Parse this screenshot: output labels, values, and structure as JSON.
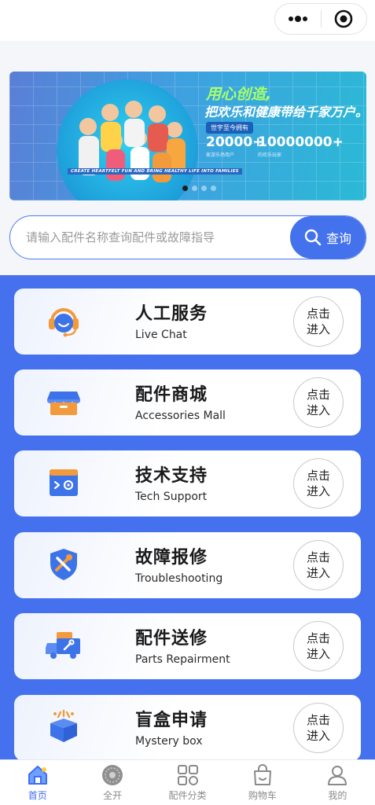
{
  "header": {
    "capsule": {
      "more_icon": "more-dots-icon",
      "close_icon": "target-icon"
    }
  },
  "banner": {
    "slogan_line1": "用心创造,",
    "slogan_line2": "把欢乐和健康带给千家万户。",
    "stat_title": "世宇至今拥有",
    "stat1_value": "20000+",
    "stat1_label": "家游乐场用户",
    "stat2_value": "10000000+",
    "stat2_label": "的欢乐玩家",
    "tagline": "CREATE HEARTFELT FUN AND BRING HEALTHY LIFE INTO FAMILIES",
    "slides": 4,
    "active_slide": 1
  },
  "search": {
    "placeholder": "请输入配件名称查询配件或故障指导",
    "button_label": "查询"
  },
  "services": [
    {
      "title": "人工服务",
      "subtitle": "Live Chat",
      "icon": "customer-service-icon",
      "action": "点击进入"
    },
    {
      "title": "配件商城",
      "subtitle": "Accessories Mall",
      "icon": "store-icon",
      "action": "点击进入"
    },
    {
      "title": "技术支持",
      "subtitle": "Tech Support",
      "icon": "terminal-gear-icon",
      "action": "点击进入"
    },
    {
      "title": "故障报修",
      "subtitle": "Troubleshooting",
      "icon": "shield-tools-icon",
      "action": "点击进入"
    },
    {
      "title": "配件送修",
      "subtitle": "Parts Repairment",
      "icon": "repair-truck-icon",
      "action": "点击进入"
    },
    {
      "title": "盲盒申请",
      "subtitle": "Mystery box",
      "icon": "mystery-box-icon",
      "action": "点击进入"
    }
  ],
  "tabbar": [
    {
      "label": "首页",
      "icon": "home-icon",
      "active": true
    },
    {
      "label": "全开",
      "icon": "logo-badge-icon",
      "active": false
    },
    {
      "label": "配件分类",
      "icon": "category-grid-icon",
      "active": false
    },
    {
      "label": "购物车",
      "icon": "shopping-bag-icon",
      "active": false
    },
    {
      "label": "我的",
      "icon": "user-icon",
      "active": false
    }
  ],
  "colors": {
    "primary": "#4571ee",
    "accent_green": "#a8ff6a",
    "icon_orange": "#f39a3c",
    "icon_blue": "#3d73e8"
  }
}
